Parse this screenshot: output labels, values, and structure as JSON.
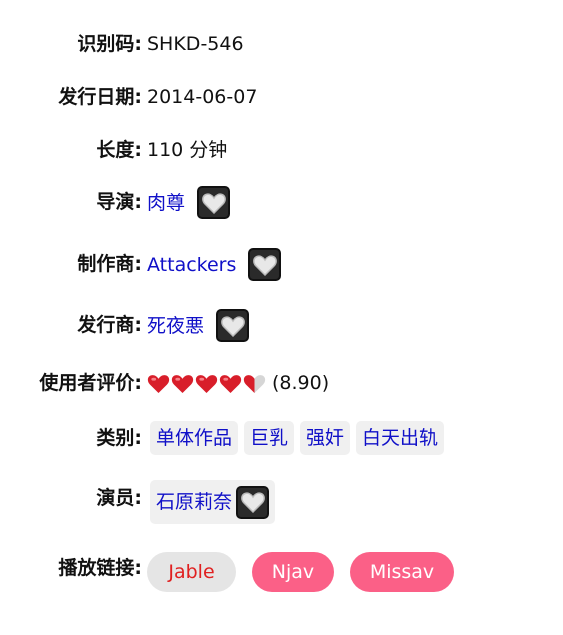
{
  "fields": {
    "id": {
      "label": "识别码:",
      "value": "SHKD-546"
    },
    "date": {
      "label": "发行日期:",
      "value": "2014-06-07"
    },
    "length": {
      "label": "长度:",
      "value": "110 分钟"
    },
    "director": {
      "label": "导演:",
      "value": "肉尊"
    },
    "maker": {
      "label": "制作商:",
      "value": "Attackers"
    },
    "publisher": {
      "label": "发行商:",
      "value": "死夜悪"
    },
    "rating": {
      "label": "使用者评价:",
      "score": "(8.90)",
      "stars_filled": 4.5,
      "stars_total": 5,
      "icon": "heart-icon",
      "star_color": "#d81e2a"
    },
    "genres": {
      "label": "类别:",
      "items": [
        "单体作品",
        "巨乳",
        "强奸",
        "白天出轨"
      ]
    },
    "actors": {
      "label": "演员:",
      "items": [
        "石原莉奈"
      ]
    },
    "play": {
      "label": "播放链接:",
      "links": [
        "Jable",
        "Njav",
        "Missav"
      ]
    }
  },
  "colors": {
    "link": "#1010c8",
    "pink": "#fb6087",
    "jable_text": "#e02020"
  },
  "icons": {
    "favorite": "heart-outline-icon"
  }
}
